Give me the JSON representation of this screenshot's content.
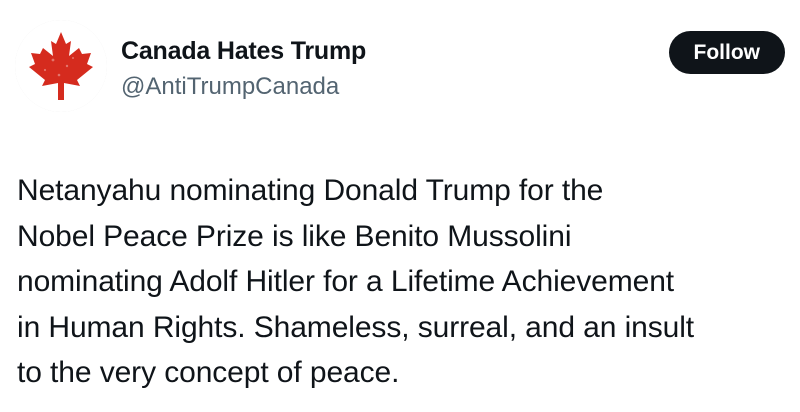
{
  "account": {
    "display_name": "Canada Hates Trump",
    "handle": "@AntiTrumpCanada",
    "avatar_icon": "maple-leaf-icon"
  },
  "actions": {
    "follow_label": "Follow"
  },
  "tweet": {
    "text": "Netanyahu nominating Donald Trump for the\nNobel Peace Prize is like Benito Mussolini\nnominating Adolf Hitler for a Lifetime Achievement\nin Human Rights. Shameless, surreal, and an insult\nto the very concept of peace."
  },
  "colors": {
    "background": "#ffffff",
    "text_primary": "#0f1419",
    "text_secondary": "#536471",
    "button_bg": "#0f1419",
    "button_text": "#ffffff",
    "maple_leaf": "#d52b1e"
  }
}
